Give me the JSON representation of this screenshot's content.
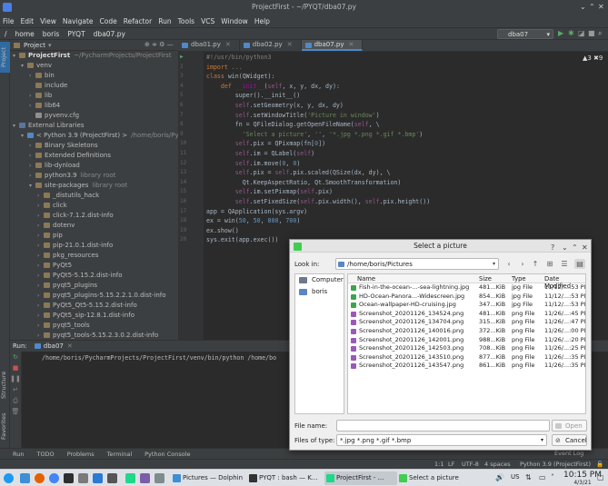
{
  "window": {
    "title": "ProjectFirst - ~/PYQT/dba07.py"
  },
  "menu": [
    "File",
    "Edit",
    "View",
    "Navigate",
    "Code",
    "Refactor",
    "Run",
    "Tools",
    "VCS",
    "Window",
    "Help"
  ],
  "breadcrumb": [
    "/",
    "home",
    "boris",
    "PYQT",
    "dba07.py"
  ],
  "run_config": "dba07",
  "left_strip": {
    "project": "Project",
    "structure": "Structure",
    "favorites": "Favorites"
  },
  "project_panel": {
    "title": "Project",
    "tree": [
      {
        "label": "ProjectFirst",
        "extra": "~/PycharmProjects/ProjectFirst",
        "indent": 0,
        "arrow": "▾",
        "icon": "fold",
        "bold": true
      },
      {
        "label": "venv",
        "extra": "",
        "indent": 1,
        "arrow": "▾",
        "icon": "fold"
      },
      {
        "label": "bin",
        "extra": "",
        "indent": 2,
        "arrow": "›",
        "icon": "fold"
      },
      {
        "label": "include",
        "extra": "",
        "indent": 2,
        "arrow": "",
        "icon": "fold"
      },
      {
        "label": "lib",
        "extra": "",
        "indent": 2,
        "arrow": "›",
        "icon": "fold"
      },
      {
        "label": "lib64",
        "extra": "",
        "indent": 2,
        "arrow": "›",
        "icon": "fold"
      },
      {
        "label": "pyvenv.cfg",
        "extra": "",
        "indent": 2,
        "arrow": "",
        "icon": "file"
      },
      {
        "label": "External Libraries",
        "extra": "",
        "indent": 0,
        "arrow": "▾",
        "icon": "foldb"
      },
      {
        "label": "< Python 3.9 (ProjectFirst) >",
        "extra": "/home/boris/Py",
        "indent": 1,
        "arrow": "▾",
        "icon": "py"
      },
      {
        "label": "Binary Skeletons",
        "extra": "",
        "indent": 2,
        "arrow": "›",
        "icon": "fold"
      },
      {
        "label": "Extended Definitions",
        "extra": "",
        "indent": 2,
        "arrow": "›",
        "icon": "fold"
      },
      {
        "label": "lib-dynload",
        "extra": "",
        "indent": 2,
        "arrow": "›",
        "icon": "fold"
      },
      {
        "label": "python3.9",
        "extra": "library root",
        "indent": 2,
        "arrow": "›",
        "icon": "fold"
      },
      {
        "label": "site-packages",
        "extra": "library root",
        "indent": 2,
        "arrow": "▾",
        "icon": "fold"
      },
      {
        "label": "_distutils_hack",
        "extra": "",
        "indent": 3,
        "arrow": "›",
        "icon": "fold"
      },
      {
        "label": "click",
        "extra": "",
        "indent": 3,
        "arrow": "›",
        "icon": "fold"
      },
      {
        "label": "click-7.1.2.dist-info",
        "extra": "",
        "indent": 3,
        "arrow": "›",
        "icon": "fold"
      },
      {
        "label": "dotenv",
        "extra": "",
        "indent": 3,
        "arrow": "›",
        "icon": "fold"
      },
      {
        "label": "pip",
        "extra": "",
        "indent": 3,
        "arrow": "›",
        "icon": "fold"
      },
      {
        "label": "pip-21.0.1.dist-info",
        "extra": "",
        "indent": 3,
        "arrow": "›",
        "icon": "fold"
      },
      {
        "label": "pkg_resources",
        "extra": "",
        "indent": 3,
        "arrow": "›",
        "icon": "fold"
      },
      {
        "label": "PyQt5",
        "extra": "",
        "indent": 3,
        "arrow": "›",
        "icon": "fold"
      },
      {
        "label": "PyQt5-5.15.2.dist-info",
        "extra": "",
        "indent": 3,
        "arrow": "›",
        "icon": "fold"
      },
      {
        "label": "pyqt5_plugins",
        "extra": "",
        "indent": 3,
        "arrow": "›",
        "icon": "fold"
      },
      {
        "label": "pyqt5_plugins-5.15.2.2.1.0.dist-info",
        "extra": "",
        "indent": 3,
        "arrow": "›",
        "icon": "fold"
      },
      {
        "label": "PyQt5_Qt5-5.15.2.dist-info",
        "extra": "",
        "indent": 3,
        "arrow": "›",
        "icon": "fold"
      },
      {
        "label": "PyQt5_sip-12.8.1.dist-info",
        "extra": "",
        "indent": 3,
        "arrow": "›",
        "icon": "fold"
      },
      {
        "label": "pyqt5_tools",
        "extra": "",
        "indent": 3,
        "arrow": "›",
        "icon": "fold"
      },
      {
        "label": "pyqt5_tools-5.15.2.3.0.2.dist-info",
        "extra": "",
        "indent": 3,
        "arrow": "›",
        "icon": "fold"
      }
    ]
  },
  "editor": {
    "tabs": [
      {
        "label": "dba01.py",
        "active": false
      },
      {
        "label": "dba02.py",
        "active": false
      },
      {
        "label": "dba07.py",
        "active": true
      }
    ],
    "inspection": "▲3  ✖9",
    "code": [
      [
        [
          "cm",
          "#!/usr/bin/python3"
        ]
      ],
      [
        [
          "kw",
          "import "
        ],
        [
          "cm",
          "..."
        ]
      ],
      [
        [
          "kw",
          "class "
        ],
        [
          "",
          "win(QWidget):"
        ]
      ],
      [
        [
          "",
          "    "
        ],
        [
          "kw",
          "def "
        ],
        [
          "pr",
          "__init__"
        ],
        [
          "",
          "("
        ],
        [
          "sf",
          "self"
        ],
        [
          "",
          ", x, y, dx, dy):"
        ]
      ],
      [
        [
          "",
          "        super().__init__()"
        ]
      ],
      [
        [
          "",
          "        "
        ],
        [
          "sf",
          "self"
        ],
        [
          "",
          ".setGeometry(x, y, dx, dy)"
        ]
      ],
      [
        [
          "",
          "        "
        ],
        [
          "sf",
          "self"
        ],
        [
          "",
          ".setWindowTitle("
        ],
        [
          "st",
          "'Picture in window'"
        ],
        [
          "",
          ")"
        ]
      ],
      [
        [
          "",
          "        fn = QFileDialog.getOpenFileName("
        ],
        [
          "sf",
          "self"
        ],
        [
          "",
          ", \\"
        ]
      ],
      [
        [
          "",
          "          "
        ],
        [
          "st",
          "'Select a picture'"
        ],
        [
          "",
          ", "
        ],
        [
          "st",
          "''"
        ],
        [
          "",
          ", "
        ],
        [
          "st",
          "'*.jpg *.png *.gif *.bmp'"
        ],
        [
          "",
          ")"
        ]
      ],
      [
        [
          "",
          "        "
        ],
        [
          "sf",
          "self"
        ],
        [
          "",
          ".pix = QPixmap(fn["
        ],
        [
          "nm",
          "0"
        ],
        [
          "",
          "])"
        ]
      ],
      [
        [
          "",
          "        "
        ],
        [
          "sf",
          "self"
        ],
        [
          "",
          ".im = QLabel("
        ],
        [
          "sf",
          "self"
        ],
        [
          "",
          ")"
        ]
      ],
      [
        [
          "",
          "        "
        ],
        [
          "sf",
          "self"
        ],
        [
          "",
          ".im.move("
        ],
        [
          "nm",
          "0"
        ],
        [
          "",
          ", "
        ],
        [
          "nm",
          "0"
        ],
        [
          "",
          ")"
        ]
      ],
      [
        [
          "",
          "        "
        ],
        [
          "sf",
          "self"
        ],
        [
          "",
          ".pix = "
        ],
        [
          "sf",
          "self"
        ],
        [
          "",
          ".pix.scaled(QSize(dx, dy), \\"
        ]
      ],
      [
        [
          "",
          "          Qt.KeepAspectRatio, Qt.SmoothTransformation)"
        ]
      ],
      [
        [
          "",
          "        "
        ],
        [
          "sf",
          "self"
        ],
        [
          "",
          ".im.setPixmap("
        ],
        [
          "sf",
          "self"
        ],
        [
          "",
          ".pix)"
        ]
      ],
      [
        [
          "",
          "        "
        ],
        [
          "sf",
          "self"
        ],
        [
          "",
          ".setFixedSize("
        ],
        [
          "sf",
          "self"
        ],
        [
          "",
          ".pix.width(), "
        ],
        [
          "sf",
          "self"
        ],
        [
          "",
          ".pix.height())"
        ]
      ],
      [
        [
          "",
          "app = QApplication(sys.argv)"
        ]
      ],
      [
        [
          "",
          "ex = win("
        ],
        [
          "nm",
          "50"
        ],
        [
          "",
          ", "
        ],
        [
          "nm",
          "50"
        ],
        [
          "",
          ", "
        ],
        [
          "nm",
          "800"
        ],
        [
          "",
          ", "
        ],
        [
          "nm",
          "700"
        ],
        [
          "",
          ")"
        ]
      ],
      [
        [
          "",
          "ex.show()"
        ]
      ],
      [
        [
          "",
          "sys.exit(app.exec())"
        ]
      ]
    ]
  },
  "run_panel": {
    "label": "Run:",
    "tab": "dba07",
    "output": "/home/boris/PycharmProjects/ProjectFirst/venv/bin/python /home/bo"
  },
  "bottom_tabs": [
    "Run",
    "TODO",
    "Problems",
    "Terminal",
    "Python Console"
  ],
  "event_log": "Event Log",
  "status": {
    "pos": "1:1",
    "lf": "LF",
    "enc": "UTF-8",
    "indent": "4 spaces",
    "interp": "Python 3.9 (ProjectFirst)"
  },
  "dialog": {
    "title": "Select a picture",
    "look_in_label": "Look in:",
    "path": "/home/boris/Pictures",
    "places": [
      "Computer",
      "boris"
    ],
    "columns": [
      "Name",
      "Size",
      "Type",
      "Date Modified"
    ],
    "files": [
      {
        "name": "Fish-in-the-ocean-...-sea-lightning.jpg",
        "size": "481...KiB",
        "type": "jpg File",
        "date": "11/12/...:53 PM",
        "kind": "jpg"
      },
      {
        "name": "HD-Ocean-Panora...-Widescreen.jpg",
        "size": "854...KiB",
        "type": "jpg File",
        "date": "11/12/...:53 PM",
        "kind": "jpg"
      },
      {
        "name": "Ocean-wallpaper-HD-cruising.jpg",
        "size": "347...KiB",
        "type": "jpg File",
        "date": "11/12/...:53 PM",
        "kind": "jpg"
      },
      {
        "name": "Screenshot_20201126_134524.png",
        "size": "481...KiB",
        "type": "png File",
        "date": "11/26/...:45 PM",
        "kind": "png"
      },
      {
        "name": "Screenshot_20201126_134704.png",
        "size": "315...KiB",
        "type": "png File",
        "date": "11/26/...:47 PM",
        "kind": "png"
      },
      {
        "name": "Screenshot_20201126_140016.png",
        "size": "372...KiB",
        "type": "png File",
        "date": "11/26/...:00 PM",
        "kind": "png"
      },
      {
        "name": "Screenshot_20201126_142001.png",
        "size": "988...KiB",
        "type": "png File",
        "date": "11/26/...:20 PM",
        "kind": "png"
      },
      {
        "name": "Screenshot_20201126_142503.png",
        "size": "708...KiB",
        "type": "png File",
        "date": "11/26/...:25 PM",
        "kind": "png"
      },
      {
        "name": "Screenshot_20201126_143510.png",
        "size": "877...KiB",
        "type": "png File",
        "date": "11/26/...:35 PM",
        "kind": "png"
      },
      {
        "name": "Screenshot_20201126_143547.png",
        "size": "861...KiB",
        "type": "png File",
        "date": "11/26/...:35 PM",
        "kind": "png"
      }
    ],
    "file_name_label": "File name:",
    "file_name_value": "",
    "file_type_label": "Files of type:",
    "file_type_value": "*.jpg *.png *.gif *.bmp",
    "open_label": "Open",
    "cancel_label": "Cancel"
  },
  "taskbar": {
    "windows": [
      {
        "label": "Pictures — Dolphin",
        "active": false,
        "color": "#3d8fd6"
      },
      {
        "label": "PYQT : bash — K...",
        "active": false,
        "color": "#333"
      },
      {
        "label": "ProjectFirst - ...",
        "active": true,
        "color": "#21d789"
      },
      {
        "label": "Select a picture",
        "active": false,
        "color": "#41cd52"
      }
    ],
    "keyboard": "US",
    "time": "10:15 PM",
    "date": "4/3/21"
  },
  "colors": {
    "accent": "#4a88c7",
    "ide_bg": "#2b2b2b",
    "panel_bg": "#3c3f41",
    "dialog_bg": "#efefef",
    "selection": "#0d293e"
  }
}
